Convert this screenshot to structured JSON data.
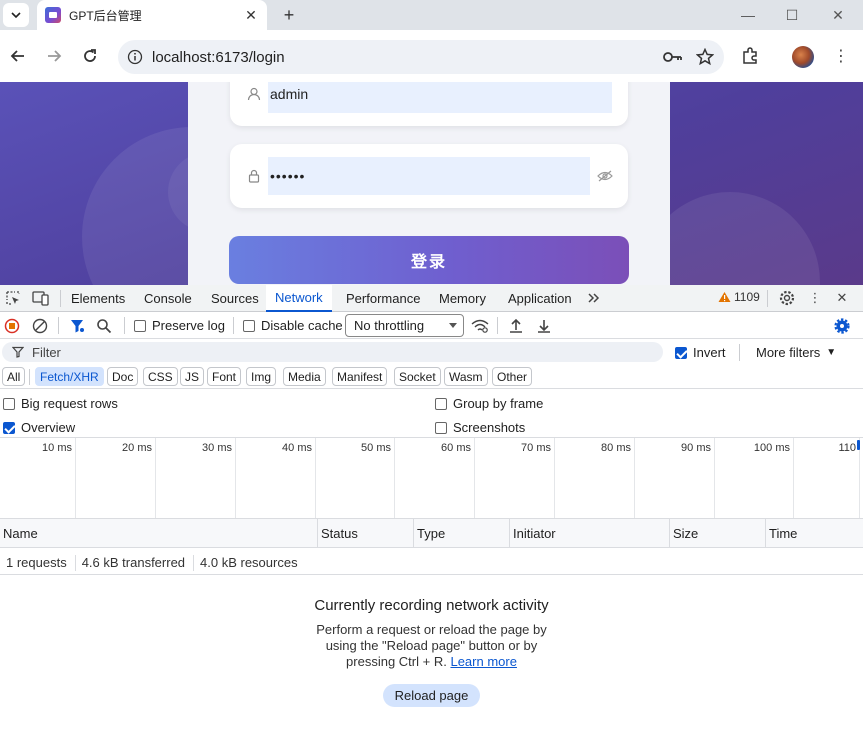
{
  "browser": {
    "tab_title": "GPT后台管理",
    "url": "localhost:6173/login"
  },
  "login": {
    "username": "admin",
    "password": "••••••",
    "submit_label": "登录"
  },
  "devtools": {
    "tabs": [
      "Elements",
      "Console",
      "Sources",
      "Network",
      "Performance",
      "Memory",
      "Application"
    ],
    "active_tab": "Network",
    "issue_count": "1109",
    "toolbar": {
      "preserve_log": "Preserve log",
      "disable_cache": "Disable cache",
      "throttling": "No throttling"
    },
    "filter": {
      "placeholder": "Filter",
      "invert": "Invert",
      "invert_checked": true,
      "more_filters": "More filters"
    },
    "type_filters": [
      "All",
      "Fetch/XHR",
      "Doc",
      "CSS",
      "JS",
      "Font",
      "Img",
      "Media",
      "Manifest",
      "Socket",
      "Wasm",
      "Other"
    ],
    "active_type_filter": "Fetch/XHR",
    "options": {
      "big_request_rows": "Big request rows",
      "group_by_frame": "Group by frame",
      "overview": "Overview",
      "screenshots": "Screenshots",
      "overview_checked": true
    },
    "timeline_ticks": [
      "10 ms",
      "20 ms",
      "30 ms",
      "40 ms",
      "50 ms",
      "60 ms",
      "70 ms",
      "80 ms",
      "90 ms",
      "100 ms",
      "110"
    ],
    "columns": [
      "Name",
      "Status",
      "Type",
      "Initiator",
      "Size",
      "Time"
    ],
    "summary": [
      "1 requests",
      "4.6 kB transferred",
      "4.0 kB resources"
    ],
    "empty_state": {
      "title": "Currently recording network activity",
      "text": "Perform a request or reload the page by using the \"Reload page\" button or by pressing Ctrl + R.",
      "link": "Learn more",
      "button": "Reload page"
    }
  },
  "colors": {
    "accent": "#0b57d0",
    "login_button_start": "#6a7fe0",
    "login_button_end": "#7b4fb8",
    "page_bg": "#4f3f9c"
  }
}
